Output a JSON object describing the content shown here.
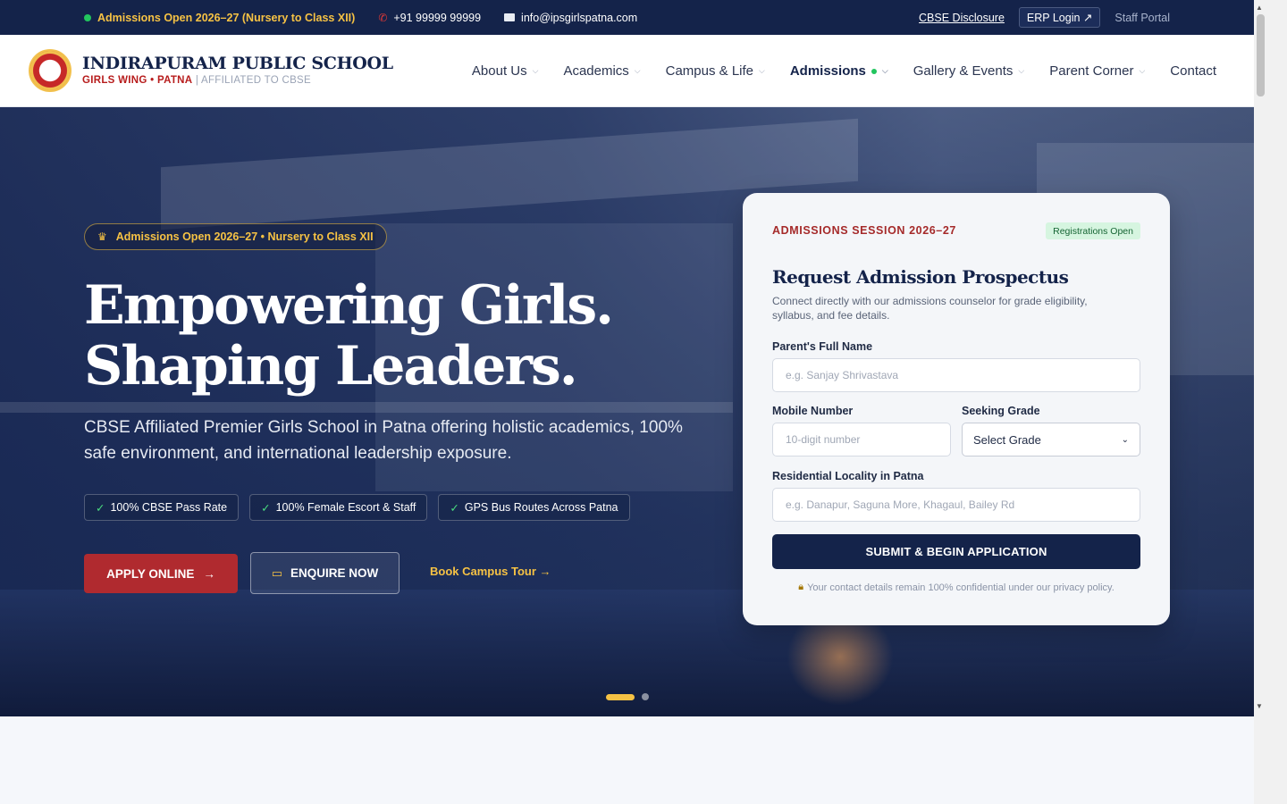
{
  "topbar": {
    "admissions": "Admissions Open 2026–27 (Nursery to Class XII)",
    "phone": "+91 99999 99999",
    "email": "info@ipsgirlspatna.com",
    "cbse_disclosure": "CBSE Disclosure",
    "erp_login": "ERP Login ↗",
    "staff_portal": "Staff Portal"
  },
  "header": {
    "school_name": "INDIRAPURAM PUBLIC SCHOOL",
    "wing": "GIRLS WING • PATNA",
    "affiliation": "| AFFILIATED TO CBSE"
  },
  "nav": {
    "items": [
      {
        "label": "About Us"
      },
      {
        "label": "Academics"
      },
      {
        "label": "Campus & Life"
      },
      {
        "label": "Admissions"
      },
      {
        "label": "Gallery & Events"
      },
      {
        "label": "Parent Corner"
      },
      {
        "label": "Contact"
      }
    ]
  },
  "hero": {
    "badge": "Admissions Open 2026–27 • Nursery to Class XII",
    "title_line1": "Empowering Girls.",
    "title_line2": "Shaping Leaders.",
    "subtitle": "CBSE Affiliated Premier Girls School in Patna offering holistic academics, 100% safe environment, and international leadership exposure.",
    "chips": [
      "100% CBSE Pass Rate",
      "100% Female Escort & Staff",
      "GPS Bus Routes Across Patna"
    ],
    "apply_label": "APPLY ONLINE",
    "enquire_label": "ENQUIRE NOW",
    "tour_label": "Book Campus Tour →"
  },
  "form": {
    "session": "ADMISSIONS SESSION 2026–27",
    "status_badge": "Registrations Open",
    "title": "Request Admission Prospectus",
    "description": "Connect directly with our admissions counselor for grade eligibility, syllabus, and fee details.",
    "name_label": "Parent's Full Name",
    "name_placeholder": "e.g. Sanjay Shrivastava",
    "mobile_label": "Mobile Number",
    "mobile_placeholder": "10-digit number",
    "grade_label": "Seeking Grade",
    "grade_selected": "Select Grade",
    "locality_label": "Residential Locality in Patna",
    "locality_placeholder": "e.g. Danapur, Saguna More, Khagaul, Bailey Rd",
    "submit_label": "SUBMIT & BEGIN APPLICATION",
    "privacy_note": "Your contact details remain 100% confidential under our privacy policy."
  },
  "colors": {
    "navy": "#14234a",
    "crimson": "#b02a2f",
    "gold": "#f6c244",
    "green": "#22c55e"
  }
}
